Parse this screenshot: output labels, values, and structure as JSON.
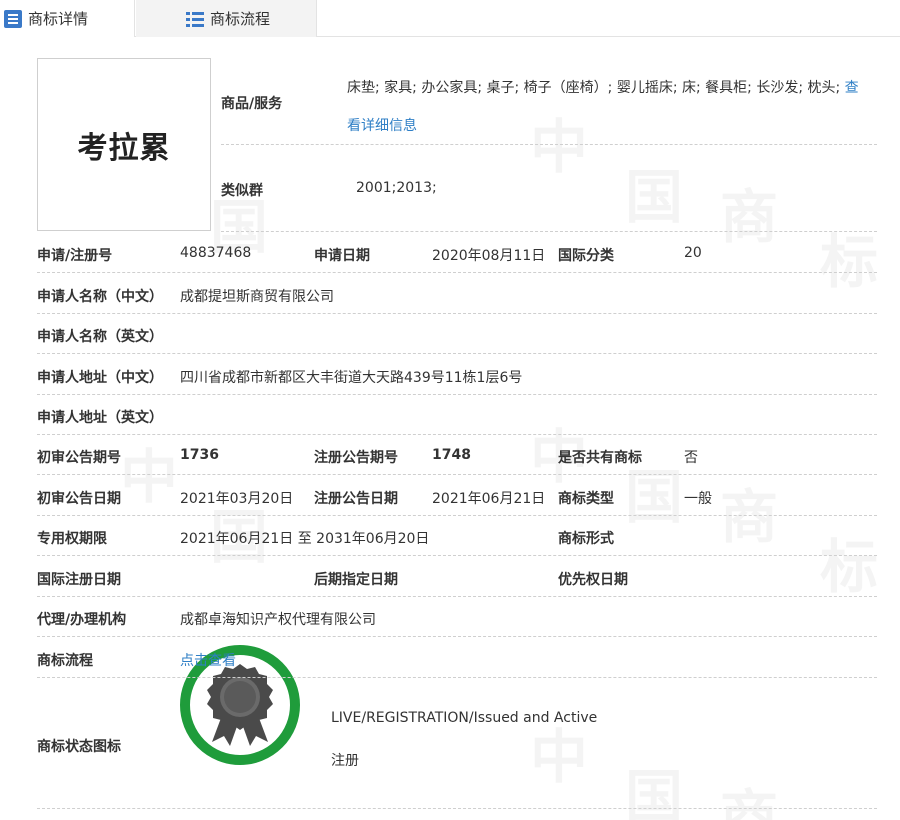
{
  "tabs": [
    {
      "label": "商标详情",
      "icon": "document-icon"
    },
    {
      "label": "商标流程",
      "icon": "list-icon"
    }
  ],
  "watermark": {
    "chars": [
      "中",
      "国",
      "商",
      "标"
    ]
  },
  "logo": {
    "text": "考拉累"
  },
  "goods": {
    "label": "商品/服务",
    "text": "床垫; 家具; 办公家具; 桌子; 椅子（座椅）; 婴儿摇床; 床; 餐具柜; 长沙发; 枕头;",
    "more_link": "查看详细信息"
  },
  "similar_group": {
    "label": "类似群",
    "value": "2001;2013;"
  },
  "rows": {
    "reg_no": {
      "label": "申请/注册号",
      "value": "48837468"
    },
    "app_date": {
      "label": "申请日期",
      "value": "2020年08月11日"
    },
    "intl_class": {
      "label": "国际分类",
      "value": "20"
    },
    "applicant_cn": {
      "label": "申请人名称（中文）",
      "value": "成都提坦斯商贸有限公司"
    },
    "applicant_en": {
      "label": "申请人名称（英文）",
      "value": ""
    },
    "address_cn": {
      "label": "申请人地址（中文）",
      "value": "四川省成都市新都区大丰街道大天路439号11栋1层6号"
    },
    "address_en": {
      "label": "申请人地址（英文）",
      "value": ""
    },
    "prelim_pub_no": {
      "label": "初审公告期号",
      "value": "1736"
    },
    "reg_pub_no": {
      "label": "注册公告期号",
      "value": "1748"
    },
    "shared": {
      "label": "是否共有商标",
      "value": "否"
    },
    "prelim_pub_date": {
      "label": "初审公告日期",
      "value": "2021年03月20日"
    },
    "reg_pub_date": {
      "label": "注册公告日期",
      "value": "2021年06月21日"
    },
    "mark_type": {
      "label": "商标类型",
      "value": "一般"
    },
    "exclusive_period": {
      "label": "专用权期限",
      "value": "2021年06月21日 至 2031年06月20日"
    },
    "mark_form": {
      "label": "商标形式",
      "value": ""
    },
    "intl_reg_date": {
      "label": "国际注册日期",
      "value": ""
    },
    "later_designation": {
      "label": "后期指定日期",
      "value": ""
    },
    "priority_date": {
      "label": "优先权日期",
      "value": ""
    },
    "agent": {
      "label": "代理/办理机构",
      "value": "成都卓海知识产权代理有限公司"
    },
    "process": {
      "label": "商标流程",
      "value": "点击查看"
    },
    "status_icon": {
      "label": "商标状态图标"
    }
  },
  "status": {
    "english": "LIVE/REGISTRATION/Issued and Active",
    "chinese": "注册",
    "ring_color": "#1f9c3b",
    "medal_color": "#4a4a4a"
  },
  "colors": {
    "accent": "#2f7fc6",
    "border": "#cfcfcf"
  }
}
